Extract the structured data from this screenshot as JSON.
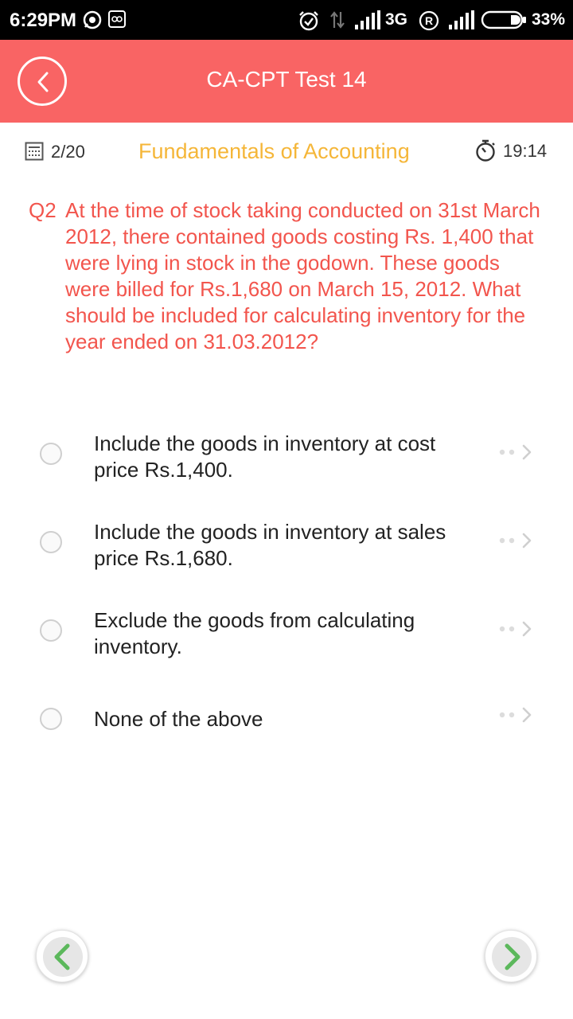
{
  "status_bar": {
    "time": "6:29PM",
    "network": "3G",
    "battery": "33%",
    "icons": [
      "whatsapp-icon",
      "app-notification-icon",
      "alarm-icon",
      "data-transfer-icon",
      "signal-icon",
      "roaming-icon",
      "signal-icon",
      "battery-icon"
    ]
  },
  "header": {
    "title": "CA-CPT Test 14",
    "back_icon": "chevron-left-icon",
    "color": "#f96464"
  },
  "info": {
    "progress": "2/20",
    "subject": "Fundamentals of Accounting",
    "subject_color": "#f5b638",
    "timer": "19:14"
  },
  "question": {
    "number": "Q2",
    "text": "At the time of stock taking conducted on 31st March 2012, there contained goods costing Rs. 1,400 that were lying in stock in the godown. These goods were billed for Rs.1,680 on March 15, 2012. What should be included for calculating inventory for the year ended on 31.03.2012?",
    "color": "#f2554d"
  },
  "options": [
    {
      "label": "Include the goods in inventory at cost price Rs.1,400."
    },
    {
      "label": "Include the goods in inventory at sales price Rs.1,680."
    },
    {
      "label": "Exclude the goods from calculating inventory."
    },
    {
      "label": "None of the above"
    }
  ],
  "navigation": {
    "prev_icon": "chevron-left-icon",
    "next_icon": "chevron-right-icon",
    "accent": "#5cb85c"
  }
}
